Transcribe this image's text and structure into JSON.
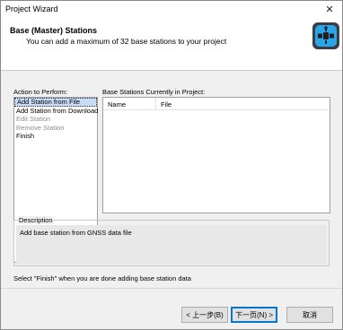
{
  "window": {
    "title": "Project Wizard",
    "close_glyph": "✕"
  },
  "header": {
    "title": "Base (Master) Stations",
    "subtitle": "You can add a maximum of 32 base stations to your project",
    "logo_icon": "satellite-icon",
    "logo_bg": "#3a3d44",
    "logo_accent": "#2aa6e8"
  },
  "actions": {
    "label": "Action to Perform:",
    "items": [
      {
        "label": "Add Station from File",
        "state": "selected"
      },
      {
        "label": "Add Station from Download",
        "state": "enabled"
      },
      {
        "label": "Edit Station",
        "state": "disabled"
      },
      {
        "label": "Remove Station",
        "state": "disabled"
      },
      {
        "label": "Finish",
        "state": "enabled"
      }
    ]
  },
  "stations": {
    "label": "Base Stations Currently in Project:",
    "columns": [
      "Name",
      "File"
    ],
    "rows": []
  },
  "description": {
    "title": "Description",
    "text": "Add base station from GNSS data file"
  },
  "hint": "Select \"Finish\" when you are done adding base station data",
  "buttons": {
    "back": "< 上一步(B)",
    "next": "下一页(N) >",
    "cancel": "取消"
  }
}
